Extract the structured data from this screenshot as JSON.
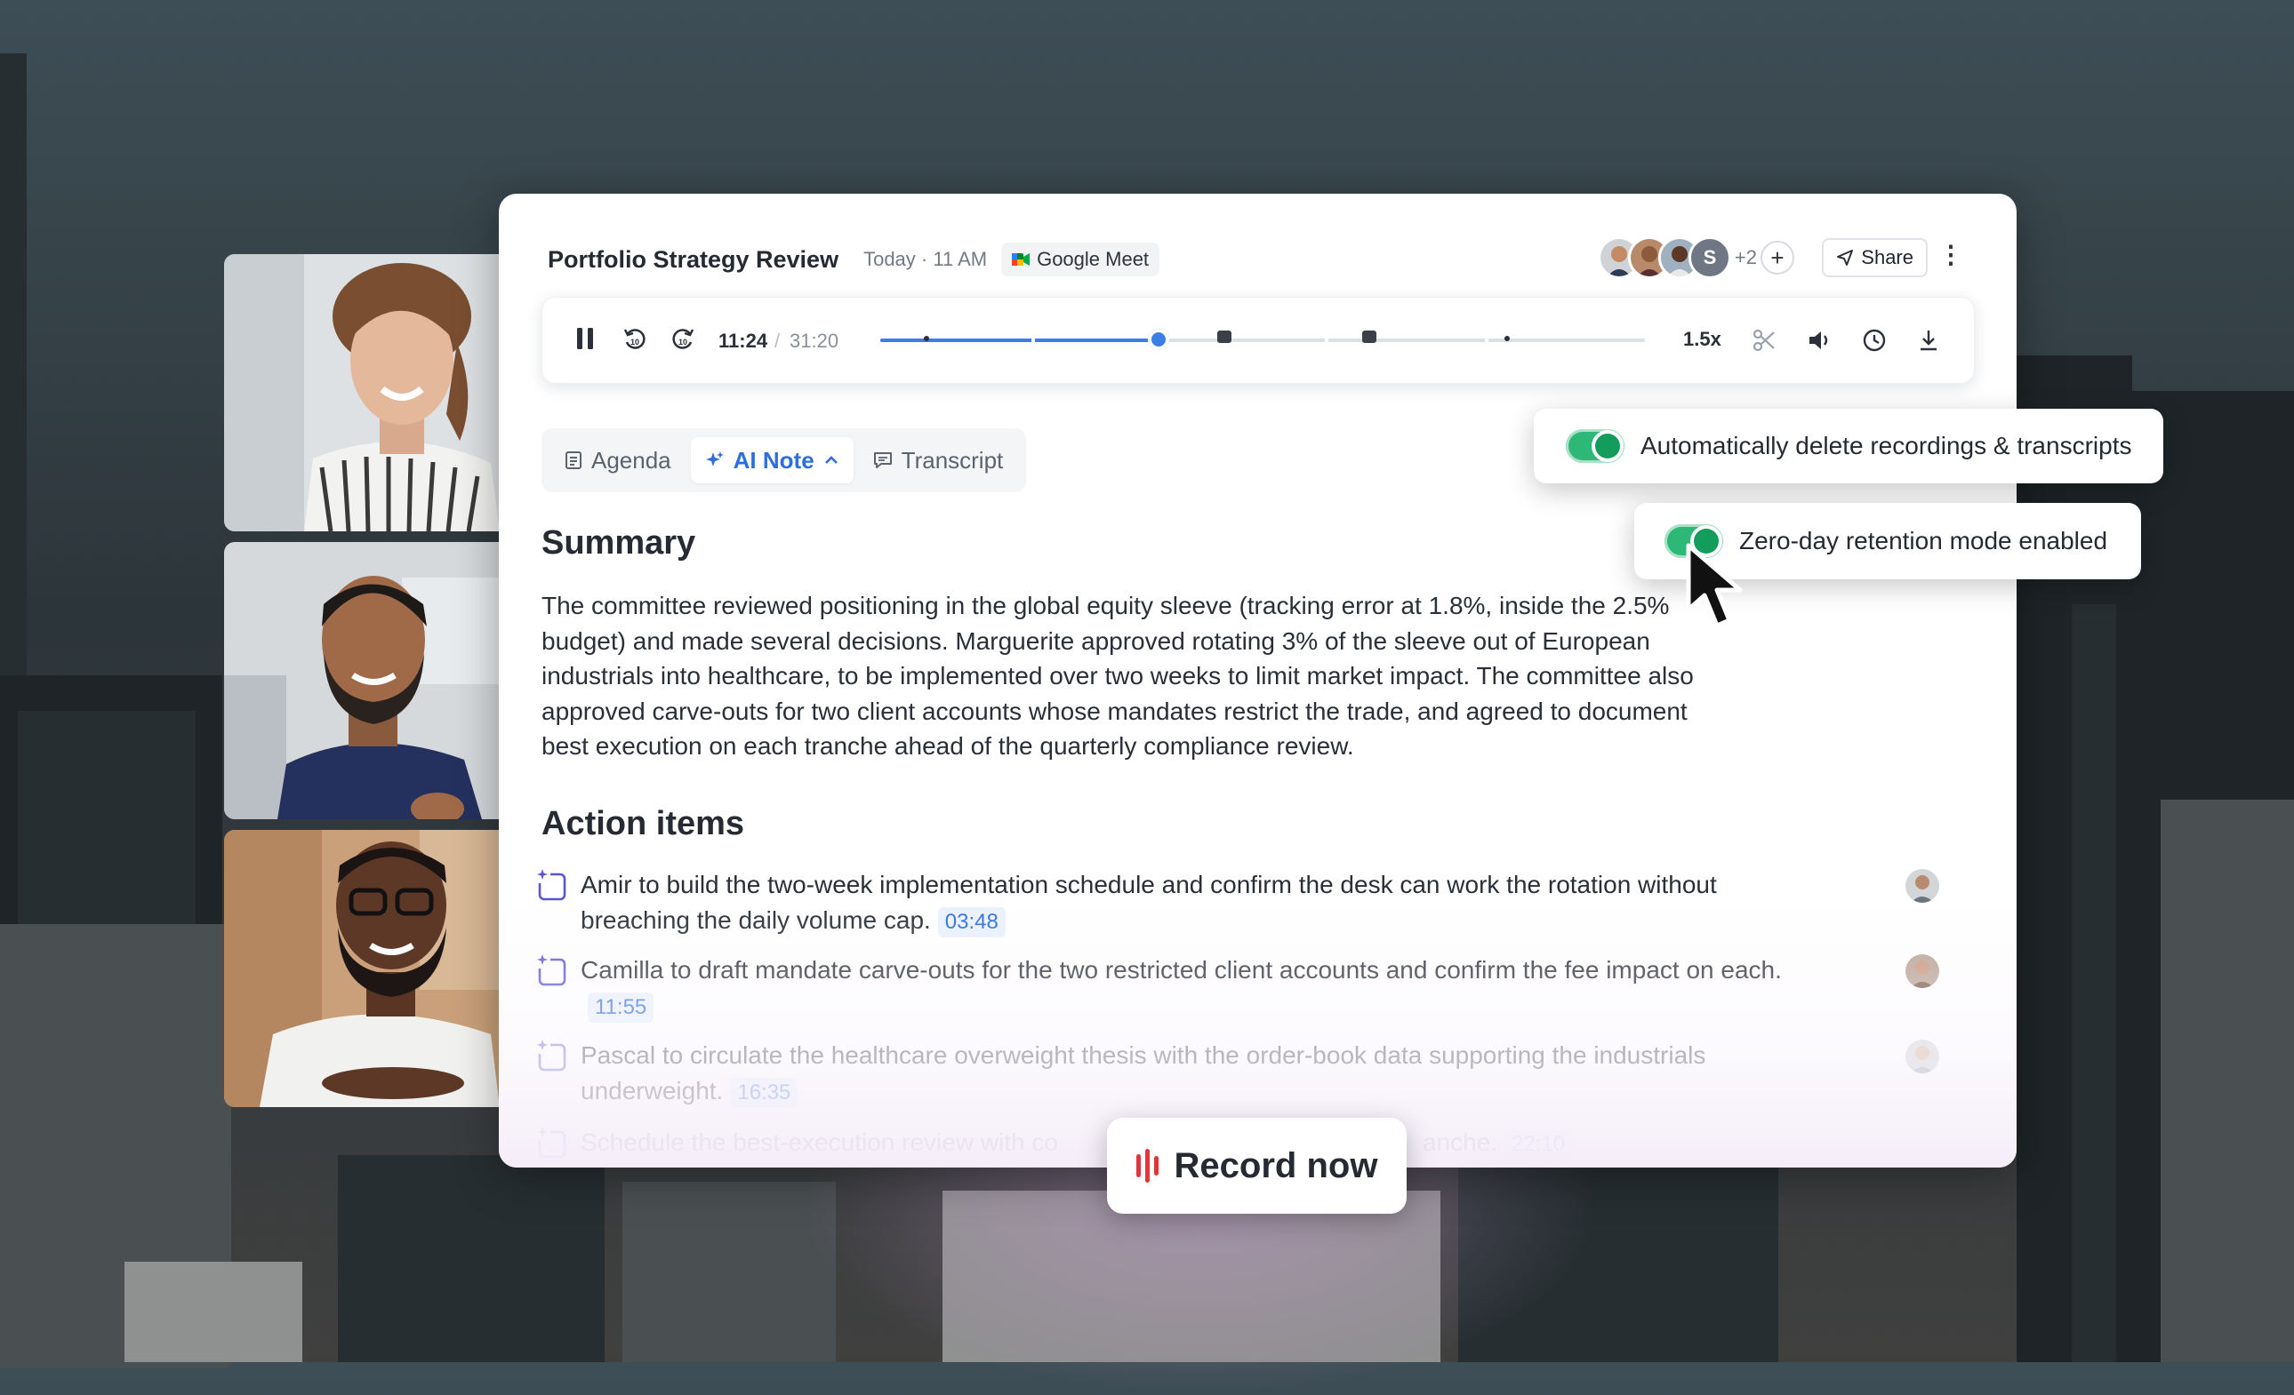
{
  "meeting": {
    "title": "Portfolio Strategy Review",
    "time": "Today · 11 AM",
    "platform": "Google Meet",
    "extra_participants": "+2",
    "add_label": "+",
    "share_label": "Share",
    "more_label": "⋮",
    "avatar_initial": "S"
  },
  "player": {
    "current_time": "11:24",
    "separator": "/",
    "total_time": "31:20",
    "progress": 0.3638,
    "speed": "1.5x",
    "comment_marks": [
      0.45,
      0.64
    ],
    "dot_marks": [
      0.06,
      0.82
    ]
  },
  "tabs": [
    {
      "label": "Agenda",
      "icon": "document-icon"
    },
    {
      "label": "AI Note",
      "icon": "sparkle-icon",
      "active": true
    },
    {
      "label": "Transcript",
      "icon": "chat-icon"
    }
  ],
  "summary": {
    "heading": "Summary",
    "text": "The committee reviewed positioning in the global equity sleeve (tracking error at 1.8%, inside the 2.5% budget) and made several decisions. Marguerite approved rotating 3% of the sleeve out of European industrials into healthcare, to be implemented over two weeks to limit market impact. The committee also approved carve-outs for two client accounts whose mandates restrict the trade, and agreed to document best execution on each tranche ahead of the quarterly compliance review."
  },
  "action_items": {
    "heading": "Action items",
    "items": [
      {
        "text": "Amir to build the two-week implementation schedule and confirm the desk can work the rotation without breaching the daily volume cap.",
        "timestamp": "03:48"
      },
      {
        "text": "Camilla to draft mandate carve-outs for the two restricted client accounts and confirm the fee impact on each.",
        "timestamp": "11:55"
      },
      {
        "text": "Pascal to circulate the healthcare overweight thesis with the order-book data supporting the industrials underweight.",
        "timestamp": "16:35"
      },
      {
        "text": "Schedule the best-execution review with co",
        "text_end": "anche.",
        "timestamp": "22:10"
      }
    ]
  },
  "popups": {
    "auto_delete": "Automatically delete recordings & transcripts",
    "zero_day": "Zero-day retention mode enabled"
  },
  "record_button": "Record now",
  "colors": {
    "accent": "#3b7ee6",
    "toggle_on": "#2db877",
    "record_red": "#e0363a"
  }
}
